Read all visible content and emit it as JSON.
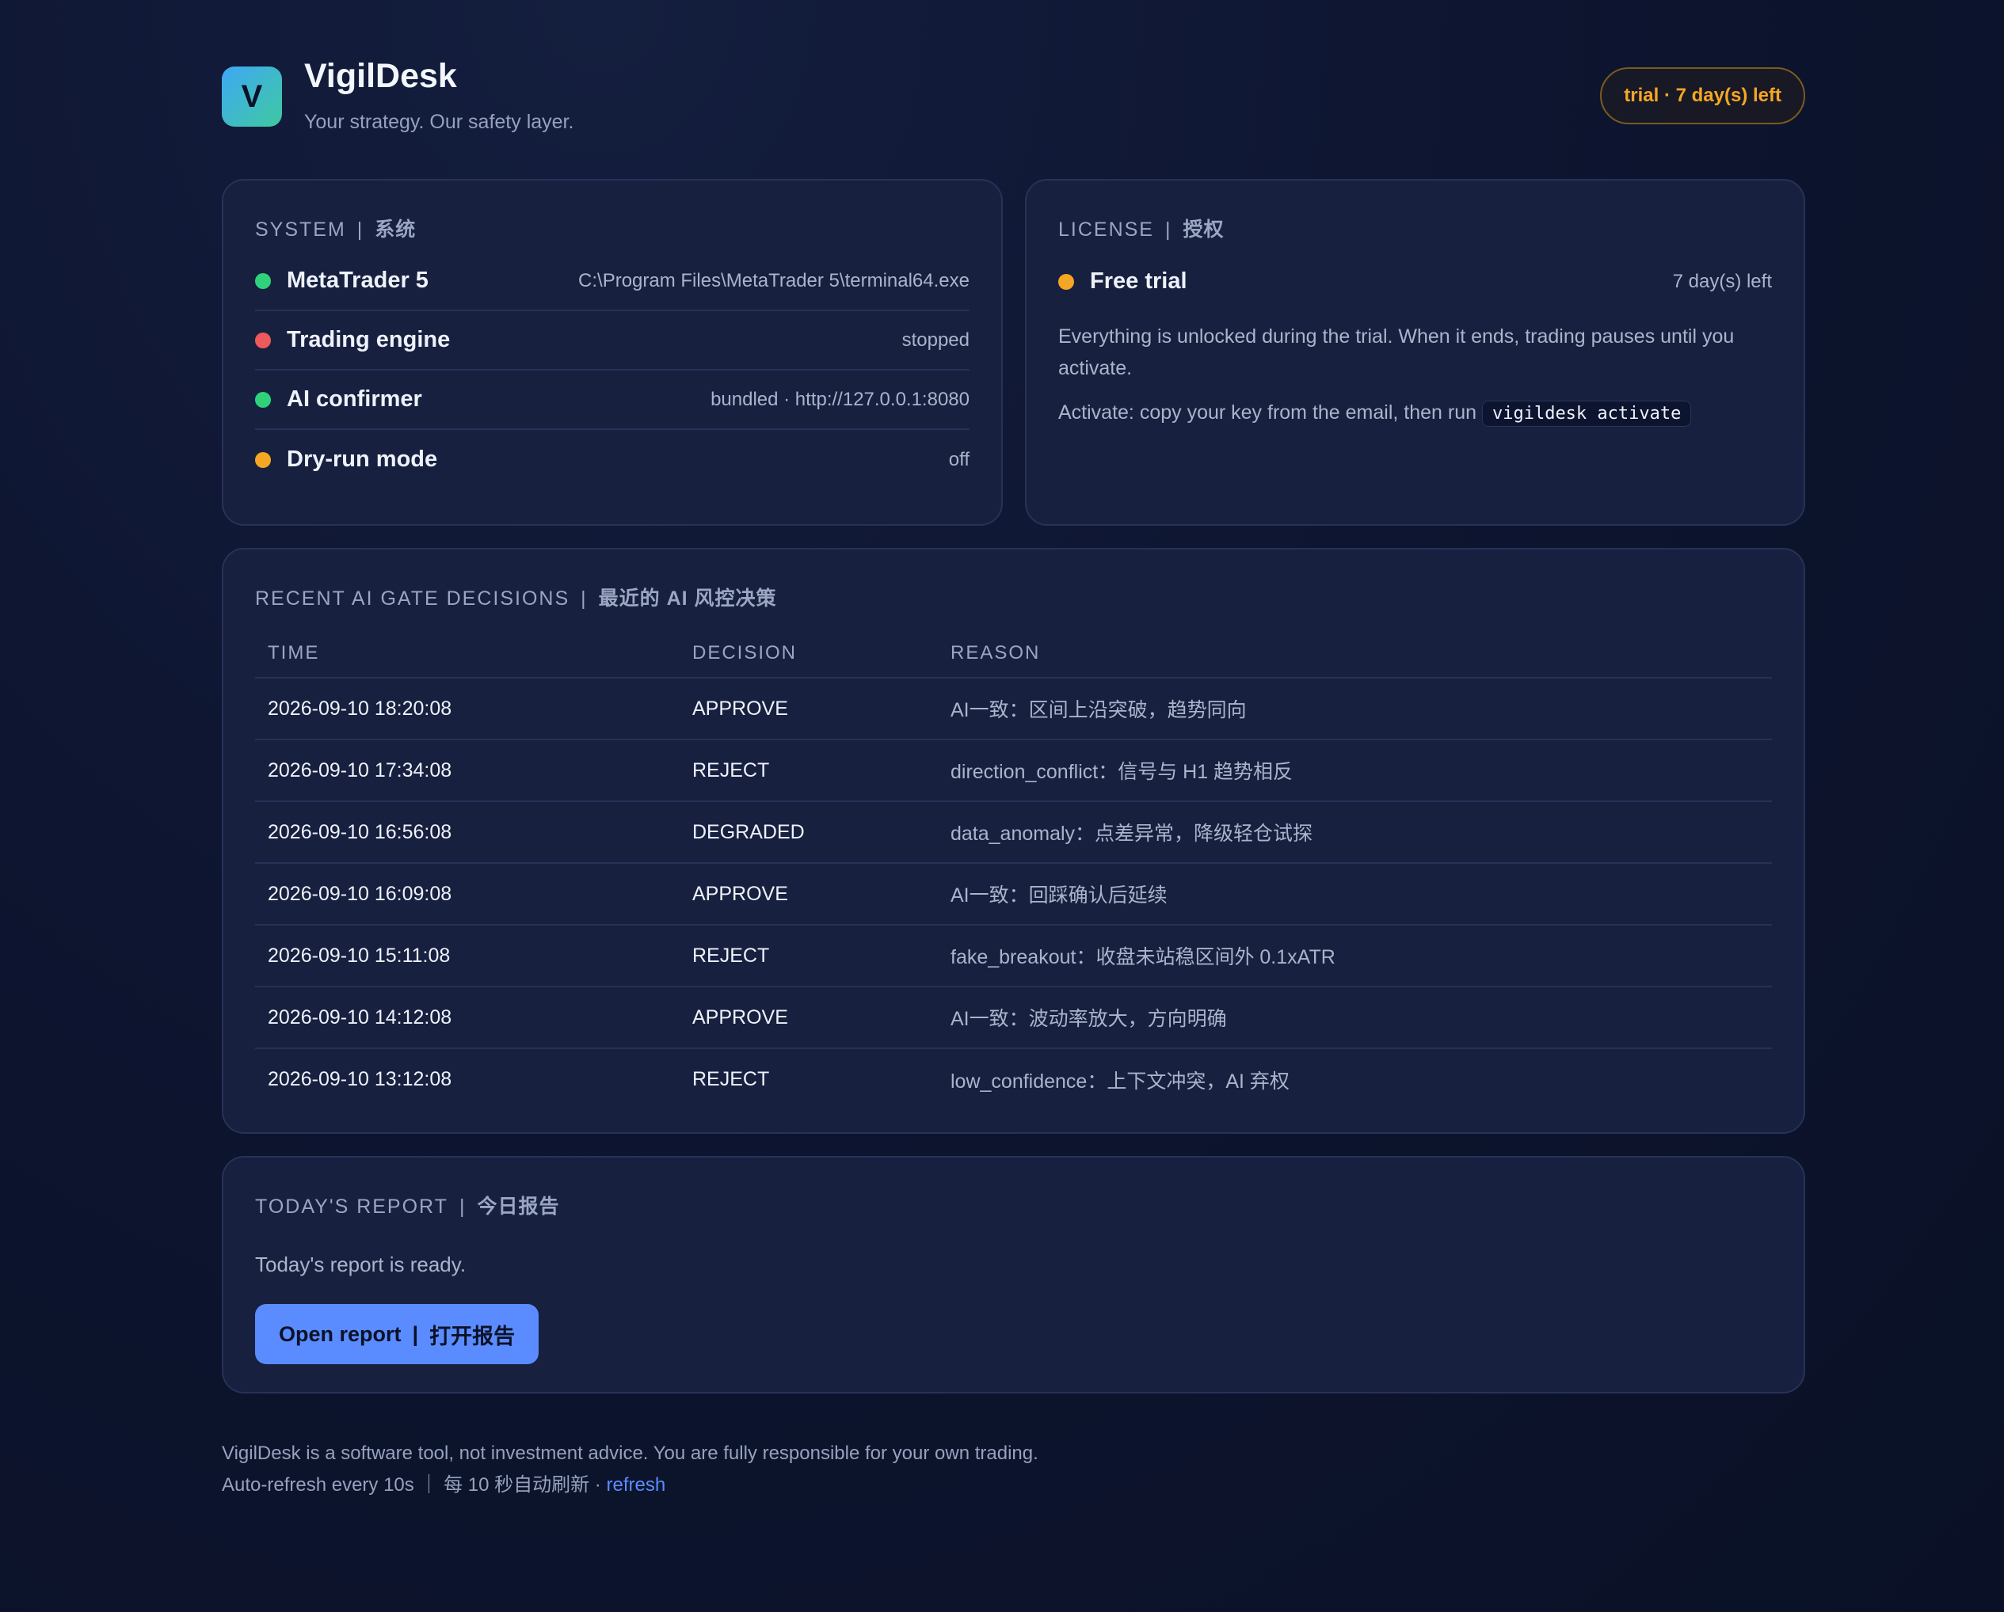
{
  "app": {
    "logo_letter": "V",
    "title": "VigilDesk",
    "subtitle": "Your strategy. Our safety layer.",
    "trial_badge": "trial · 7 day(s) left"
  },
  "system": {
    "title_en": "SYSTEM",
    "title_cn": "系统",
    "rows": [
      {
        "name": "MetaTrader 5",
        "value": "C:\\Program Files\\MetaTrader 5\\terminal64.exe",
        "status": "green"
      },
      {
        "name": "Trading engine",
        "value": "stopped",
        "status": "red"
      },
      {
        "name": "AI confirmer",
        "value": "bundled · http://127.0.0.1:8080",
        "status": "green"
      },
      {
        "name": "Dry-run mode",
        "value": "off",
        "status": "amber"
      }
    ]
  },
  "license": {
    "title_en": "LICENSE",
    "title_cn": "授权",
    "plan": "Free trial",
    "remaining": "7 day(s) left",
    "description": "Everything is unlocked during the trial. When it ends, trading pauses until you activate.",
    "activate_text": "Activate: copy your key from the email, then run",
    "activate_command": "vigildesk activate"
  },
  "decisions": {
    "title_en": "RECENT AI GATE DECISIONS",
    "title_cn": "最近的 AI 风控决策",
    "columns": [
      "TIME",
      "DECISION",
      "REASON"
    ],
    "rows": [
      [
        "2026-09-10 18:20:08",
        "APPROVE",
        "AI一致：区间上沿突破，趋势同向"
      ],
      [
        "2026-09-10 17:34:08",
        "REJECT",
        "direction_conflict：信号与 H1 趋势相反"
      ],
      [
        "2026-09-10 16:56:08",
        "DEGRADED",
        "data_anomaly：点差异常，降级轻仓试探"
      ],
      [
        "2026-09-10 16:09:08",
        "APPROVE",
        "AI一致：回踩确认后延续"
      ],
      [
        "2026-09-10 15:11:08",
        "REJECT",
        "fake_breakout：收盘未站稳区间外 0.1xATR"
      ],
      [
        "2026-09-10 14:12:08",
        "APPROVE",
        "AI一致：波动率放大，方向明确"
      ],
      [
        "2026-09-10 13:12:08",
        "REJECT",
        "low_confidence：上下文冲突，AI 弃权"
      ]
    ]
  },
  "report": {
    "title_en": "TODAY'S REPORT",
    "title_cn": "今日报告",
    "status_text": "Today's report is ready.",
    "button_en": "Open report",
    "button_cn": "打开报告"
  },
  "footer": {
    "disclaimer": "VigilDesk is a software tool, not investment advice. You are fully responsible for your own trading.",
    "refresh_text": "Auto-refresh every 10s ｜ 每 10 秒自动刷新 ·",
    "refresh_link": "refresh"
  },
  "colors": {
    "accent": "#5b8cff",
    "ok": "#2fd27a",
    "error": "#f0595b",
    "warning": "#f5a623"
  }
}
